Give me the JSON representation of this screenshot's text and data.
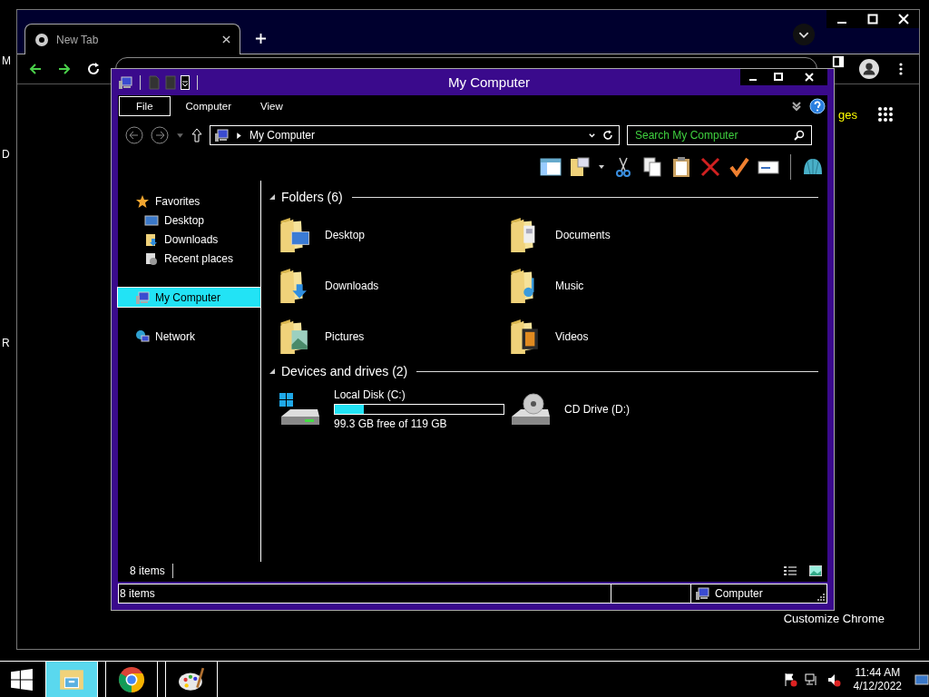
{
  "desktop_labels": [
    "M",
    "D",
    "R"
  ],
  "browser": {
    "tabs": [
      {
        "title": "New Tab",
        "selected": true
      }
    ],
    "partial_link": "ges",
    "customize": "Customize Chrome"
  },
  "explorer": {
    "title": "My Computer",
    "ribbon_tabs": [
      {
        "label": "File",
        "selected": true
      },
      {
        "label": "Computer",
        "selected": false
      },
      {
        "label": "View",
        "selected": false
      }
    ],
    "address": "My Computer",
    "search": {
      "placeholder": "Search My Computer"
    },
    "nav": [
      {
        "label": "Favorites",
        "kind": "favorites",
        "selected": false,
        "children": [
          {
            "label": "Desktop",
            "kind": "desktop",
            "selected": false
          },
          {
            "label": "Downloads",
            "kind": "downloads",
            "selected": false
          },
          {
            "label": "Recent places",
            "kind": "recent",
            "selected": false
          }
        ]
      },
      {
        "label": "My Computer",
        "kind": "computer",
        "selected": true
      },
      {
        "label": "Network",
        "kind": "network",
        "selected": false
      }
    ],
    "groups": [
      {
        "title": "Folders (6)",
        "expanded": true,
        "items": [
          {
            "label": "Desktop",
            "kind": "desktop"
          },
          {
            "label": "Documents",
            "kind": "documents"
          },
          {
            "label": "Downloads",
            "kind": "downloads"
          },
          {
            "label": "Music",
            "kind": "music"
          },
          {
            "label": "Pictures",
            "kind": "pictures"
          },
          {
            "label": "Videos",
            "kind": "videos"
          }
        ]
      },
      {
        "title": "Devices and drives (2)",
        "expanded": true,
        "items": [
          {
            "label": "Local Disk (C:)",
            "kind": "disk",
            "level": 0.17,
            "detail": "99.3 GB free of 119 GB"
          },
          {
            "label": "CD Drive (D:)",
            "kind": "cd"
          }
        ]
      }
    ],
    "item_count": "8 items",
    "status": {
      "left": "8 items",
      "right": "Computer"
    }
  },
  "taskbar": {
    "apps": [
      {
        "kind": "explorer",
        "selected": true
      },
      {
        "kind": "chrome",
        "selected": false
      },
      {
        "kind": "paint",
        "selected": false
      }
    ],
    "time": "11:44 AM",
    "date": "4/12/2022"
  }
}
